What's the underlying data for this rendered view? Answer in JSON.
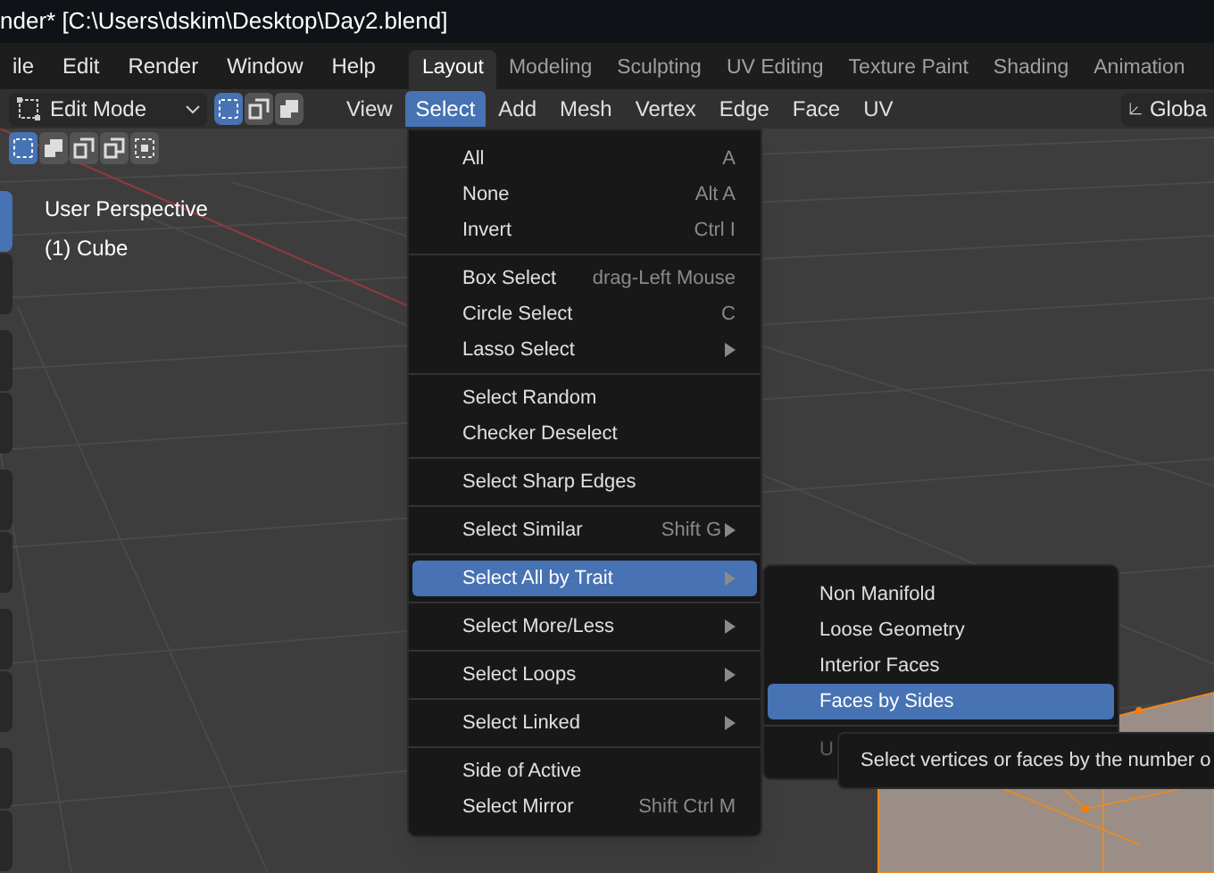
{
  "window": {
    "title": "nder* [C:\\Users\\dskim\\Desktop\\Day2.blend]"
  },
  "menubar": [
    "ile",
    "Edit",
    "Render",
    "Window",
    "Help"
  ],
  "workspaces": [
    {
      "label": "Layout",
      "selected": true
    },
    {
      "label": "Modeling",
      "selected": false
    },
    {
      "label": "Sculpting",
      "selected": false
    },
    {
      "label": "UV Editing",
      "selected": false
    },
    {
      "label": "Texture Paint",
      "selected": false
    },
    {
      "label": "Shading",
      "selected": false
    },
    {
      "label": "Animation",
      "selected": false
    }
  ],
  "header": {
    "mode": "Edit Mode",
    "select_modes": [
      {
        "selected": true
      },
      {
        "selected": false
      },
      {
        "selected": false
      }
    ],
    "menus": [
      {
        "label": "View",
        "selected": false
      },
      {
        "label": "Select",
        "selected": true
      },
      {
        "label": "Add",
        "selected": false
      },
      {
        "label": "Mesh",
        "selected": false
      },
      {
        "label": "Vertex",
        "selected": false
      },
      {
        "label": "Edge",
        "selected": false
      },
      {
        "label": "Face",
        "selected": false
      },
      {
        "label": "UV",
        "selected": false
      }
    ],
    "transform": "Globa"
  },
  "tool_settings": [
    {
      "selected": true
    },
    {
      "selected": false
    },
    {
      "selected": false
    },
    {
      "selected": false
    },
    {
      "selected": false
    }
  ],
  "toolbar": [
    {
      "selected": true
    },
    {
      "selected": false
    },
    {
      "selected": false
    },
    {
      "selected": false
    },
    {
      "selected": false
    },
    {
      "selected": false
    },
    {
      "selected": false
    },
    {
      "selected": false
    },
    {
      "selected": false
    },
    {
      "selected": false
    }
  ],
  "viewport": {
    "view_name": "User Perspective",
    "object": "(1) Cube"
  },
  "select_menu": [
    [
      {
        "label": "All",
        "shortcut": "A",
        "submenu": false,
        "selected": false
      },
      {
        "label": "None",
        "shortcut": "Alt A",
        "submenu": false,
        "selected": false
      },
      {
        "label": "Invert",
        "shortcut": "Ctrl I",
        "submenu": false,
        "selected": false
      }
    ],
    [
      {
        "label": "Box Select",
        "shortcut": "drag-Left Mouse",
        "submenu": false,
        "selected": false
      },
      {
        "label": "Circle Select",
        "shortcut": "C",
        "submenu": false,
        "selected": false
      },
      {
        "label": "Lasso Select",
        "submenu": true,
        "selected": false
      }
    ],
    [
      {
        "label": "Select Random",
        "submenu": false,
        "selected": false
      },
      {
        "label": "Checker Deselect",
        "submenu": false,
        "selected": false
      }
    ],
    [
      {
        "label": "Select Sharp Edges",
        "submenu": false,
        "selected": false
      }
    ],
    [
      {
        "label": "Select Similar",
        "shortcut": "Shift G",
        "submenu": true,
        "selected": false
      }
    ],
    [
      {
        "label": "Select All by Trait",
        "submenu": true,
        "selected": true
      }
    ],
    [
      {
        "label": "Select More/Less",
        "submenu": true,
        "selected": false
      }
    ],
    [
      {
        "label": "Select Loops",
        "submenu": true,
        "selected": false
      }
    ],
    [
      {
        "label": "Select Linked",
        "submenu": true,
        "selected": false
      }
    ],
    [
      {
        "label": "Side of Active",
        "submenu": false,
        "selected": false
      },
      {
        "label": "Select Mirror",
        "shortcut": "Shift Ctrl M",
        "submenu": false,
        "selected": false
      }
    ]
  ],
  "trait_submenu": [
    [
      {
        "label": "Non Manifold",
        "selected": false,
        "disabled": false
      },
      {
        "label": "Loose Geometry",
        "selected": false,
        "disabled": false
      },
      {
        "label": "Interior Faces",
        "selected": false,
        "disabled": false
      },
      {
        "label": "Faces by Sides",
        "selected": true,
        "disabled": false
      }
    ],
    [
      {
        "label": "U",
        "selected": false,
        "disabled": true
      }
    ]
  ],
  "tooltip": "Select vertices or faces by the number o"
}
